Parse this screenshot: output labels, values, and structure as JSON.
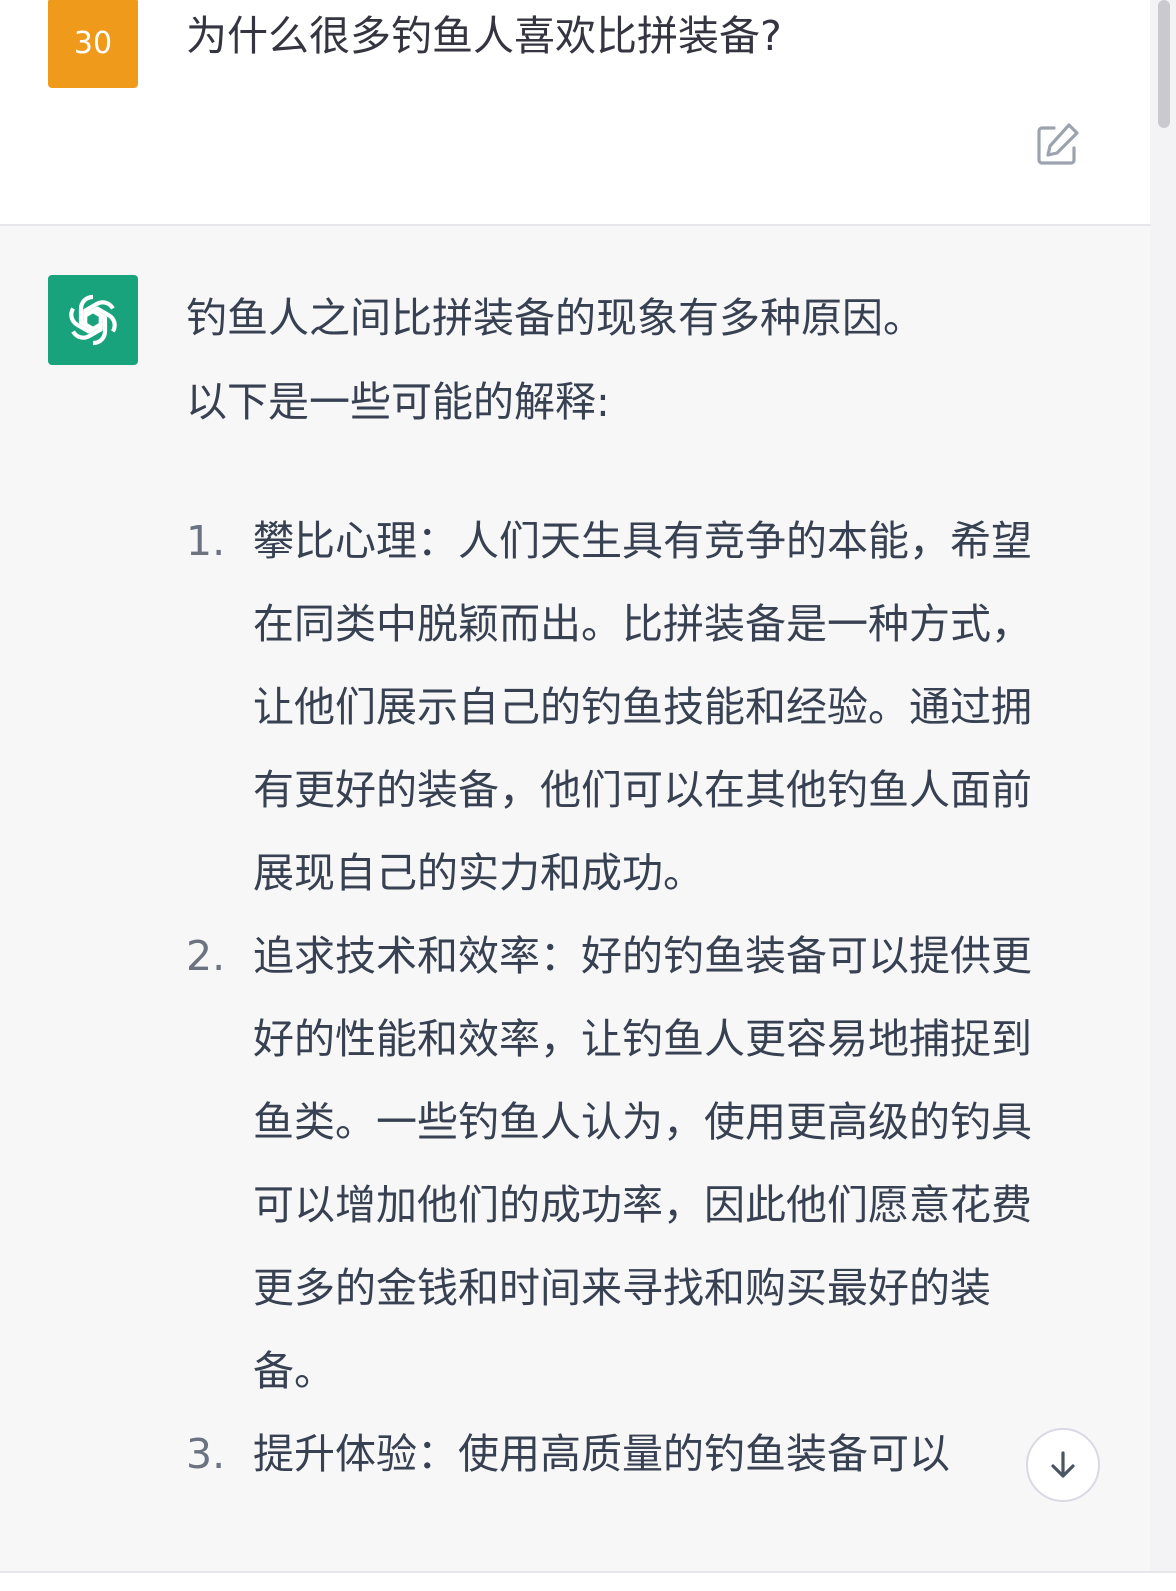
{
  "user_message": {
    "avatar_text": "30",
    "text": "为什么很多钓鱼人喜欢比拼装备?",
    "edit_icon": "edit-icon"
  },
  "assistant_message": {
    "avatar_icon": "openai-logo-icon",
    "intro_line1": "钓鱼人之间比拼装备的现象有多种原因。",
    "intro_line2": "以下是一些可能的解释:",
    "items": [
      {
        "number": "1.",
        "text": "攀比心理：人们天生具有竞争的本能，希望在同类中脱颖而出。比拼装备是一种方式，让他们展示自己的钓鱼技能和经验。通过拥有更好的装备，他们可以在其他钓鱼人面前展现自己的实力和成功。"
      },
      {
        "number": "2.",
        "text": "追求技术和效率：好的钓鱼装备可以提供更好的性能和效率，让钓鱼人更容易地捕捉到鱼类。一些钓鱼人认为，使用更高级的钓具可以增加他们的成功率，因此他们愿意花费更多的金钱和时间来寻找和购买最好的装备。"
      },
      {
        "number": "3.",
        "text": "提升体验：使用高质量的钓鱼装备可以"
      }
    ]
  },
  "scroll_button_icon": "arrow-down-icon",
  "colors": {
    "user_avatar": "#f09a1b",
    "bot_avatar": "#19a37d",
    "assistant_bg": "#f7f7f8"
  }
}
